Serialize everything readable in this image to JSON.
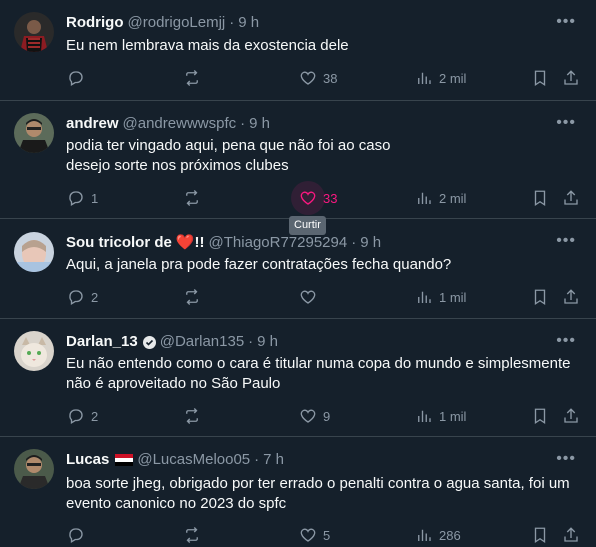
{
  "colors": {
    "background": "#15202b",
    "divider": "#38444d",
    "text": "#f7f9f9",
    "secondary": "#8b98a5",
    "like_active": "#f91880"
  },
  "tweets": [
    {
      "name": "Rodrigo",
      "handle": "@rodrigoLemjj",
      "dot": "·",
      "time": "9 h",
      "lines": [
        "Eu nem lembrava mais da exostencia dele"
      ],
      "replies": "",
      "retweets": "",
      "likes": "38",
      "views": "2 mil"
    },
    {
      "name": "andrew",
      "handle": "@andrewwwspfc",
      "dot": "·",
      "time": "9 h",
      "lines": [
        "podia ter vingado aqui, pena que não foi ao caso",
        "desejo sorte nos próximos clubes"
      ],
      "replies": "1",
      "retweets": "",
      "likes": "33",
      "views": "2 mil"
    },
    {
      "name": "Sou tricolor de",
      "name_suffix": "!!",
      "handle": "@ThiagoR77295294",
      "dot": "·",
      "time": "9 h",
      "lines": [
        "Aqui, a janela pra pode fazer contratações fecha quando?"
      ],
      "replies": "2",
      "retweets": "",
      "likes": "",
      "views": "1 mil"
    },
    {
      "name": "Darlan_13",
      "handle": "@Darlan135",
      "dot": "·",
      "time": "9 h",
      "lines": [
        "Eu não entendo como o cara é titular numa copa do mundo e simplesmente",
        "não é aproveitado no São Paulo"
      ],
      "replies": "2",
      "retweets": "",
      "likes": "9",
      "views": "1 mil"
    },
    {
      "name": "Lucas",
      "handle": "@LucasMeloo05",
      "dot": "·",
      "time": "7 h",
      "lines": [
        "boa sorte jheg, obrigado por ter errado o penalti contra o agua santa, foi um",
        "evento canonico no 2023 do spfc"
      ],
      "replies": "",
      "retweets": "",
      "likes": "5",
      "views": "286"
    }
  ],
  "tooltip": "Curtir",
  "icons": [
    "reply-icon",
    "retweet-icon",
    "like-icon",
    "views-icon",
    "bookmark-icon",
    "share-icon",
    "more-icon",
    "verified-icon",
    "heart-emoji",
    "flag-emoji"
  ]
}
